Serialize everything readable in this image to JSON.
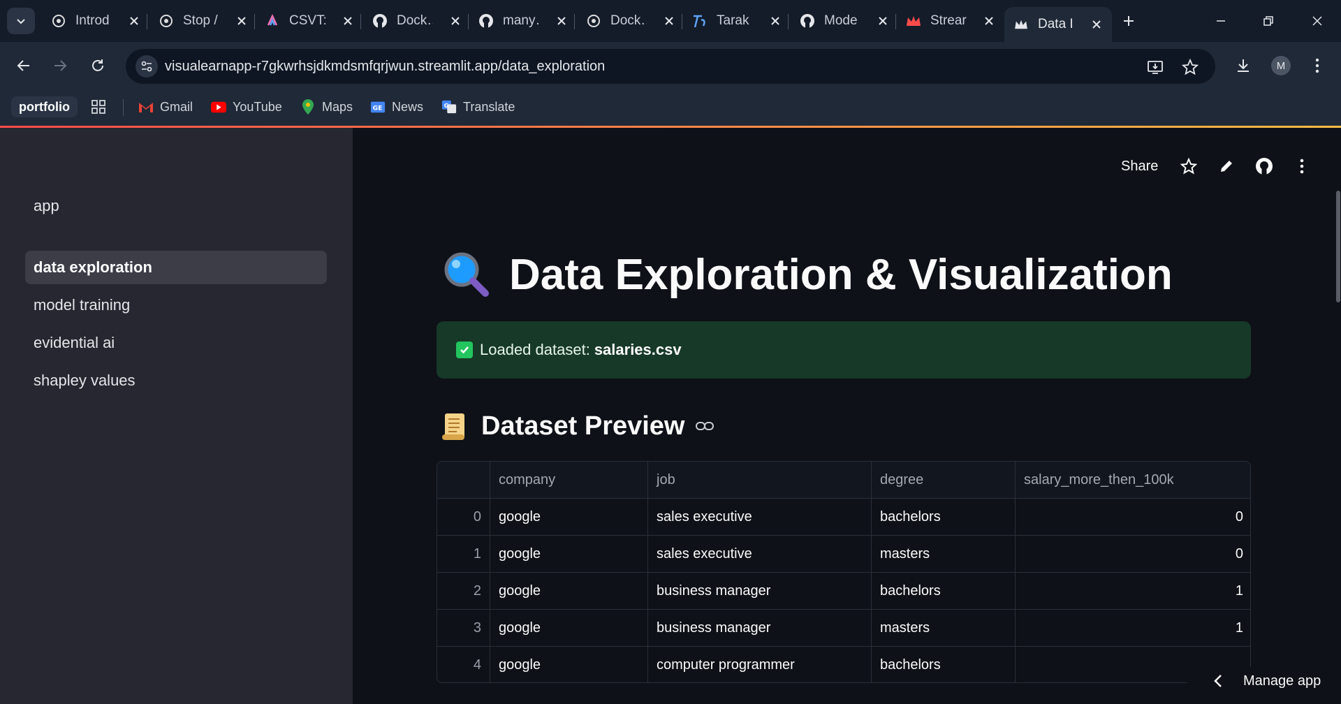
{
  "browser": {
    "tabs": [
      {
        "title": "Introd",
        "icon": "openai-icon"
      },
      {
        "title": "Stop /",
        "icon": "openai-icon"
      },
      {
        "title": "CSVT:",
        "icon": "csv-icon"
      },
      {
        "title": "Dock…",
        "icon": "github-icon"
      },
      {
        "title": "many…",
        "icon": "github-icon"
      },
      {
        "title": "Dock…",
        "icon": "openai-icon"
      },
      {
        "title": "Tarak",
        "icon": "tarak-icon"
      },
      {
        "title": "Mode",
        "icon": "github-icon"
      },
      {
        "title": "Strear",
        "icon": "streamlit-crown-icon"
      },
      {
        "title": "Data I",
        "icon": "streamlit-crown-icon",
        "active": true
      }
    ],
    "url": "visualearnapp-r7gkwrhsjdkmdsmfqrjwun.streamlit.app/data_exploration",
    "avatar_initial": "M",
    "bookmarks": [
      {
        "label": "portfolio"
      },
      {
        "label": "Gmail",
        "icon": "gmail-icon"
      },
      {
        "label": "YouTube",
        "icon": "youtube-icon"
      },
      {
        "label": "Maps",
        "icon": "maps-icon"
      },
      {
        "label": "News",
        "icon": "news-icon"
      },
      {
        "label": "Translate",
        "icon": "translate-icon"
      }
    ]
  },
  "sidebar": {
    "items": [
      {
        "label": "app"
      },
      {
        "label": "data exploration",
        "active": true
      },
      {
        "label": "model training"
      },
      {
        "label": "evidential ai"
      },
      {
        "label": "shapley values"
      }
    ]
  },
  "header": {
    "share_label": "Share"
  },
  "main": {
    "title": "Data Exploration & Visualization",
    "success_prefix": "Loaded dataset:",
    "success_file": "salaries.csv",
    "preview_title": "Dataset Preview"
  },
  "table": {
    "columns": [
      "",
      "company",
      "job",
      "degree",
      "salary_more_then_100k"
    ],
    "rows": [
      [
        "0",
        "google",
        "sales executive",
        "bachelors",
        "0"
      ],
      [
        "1",
        "google",
        "sales executive",
        "masters",
        "0"
      ],
      [
        "2",
        "google",
        "business manager",
        "bachelors",
        "1"
      ],
      [
        "3",
        "google",
        "business manager",
        "masters",
        "1"
      ],
      [
        "4",
        "google",
        "computer programmer",
        "bachelors",
        ""
      ]
    ]
  },
  "footer": {
    "manage_label": "Manage app"
  },
  "colors": {
    "success_bg": "#173928",
    "accent_gradient_start": "#ff4b4b",
    "accent_gradient_end": "#ffbd45",
    "sidebar_bg": "#262730",
    "main_bg": "#0e1117"
  }
}
